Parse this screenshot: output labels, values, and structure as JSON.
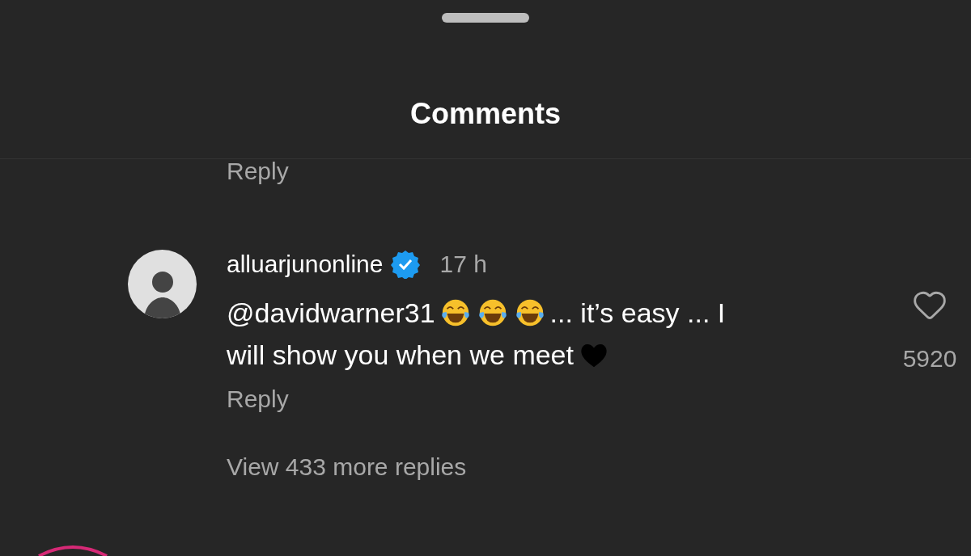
{
  "sheet": {
    "title": "Comments"
  },
  "previous_comment": {
    "reply_label": "Reply"
  },
  "comment": {
    "username": "alluarjunonline",
    "verified": true,
    "time": "17 h",
    "liked": false,
    "likes": "5920",
    "reply_label": "Reply",
    "view_replies": "View 433 more replies",
    "message_lines": [
      [
        {
          "kind": "text",
          "text": "@davidwarner31"
        },
        {
          "kind": "laugh-emoji"
        },
        {
          "kind": "laugh-emoji"
        },
        {
          "kind": "laugh-emoji"
        },
        {
          "kind": "text",
          "text": "... it’s easy ... I"
        }
      ],
      [
        {
          "kind": "text",
          "text": "will show you when we meet"
        },
        {
          "kind": "heart-emoji"
        }
      ]
    ]
  },
  "next_comment": {
    "story_ring": true
  }
}
